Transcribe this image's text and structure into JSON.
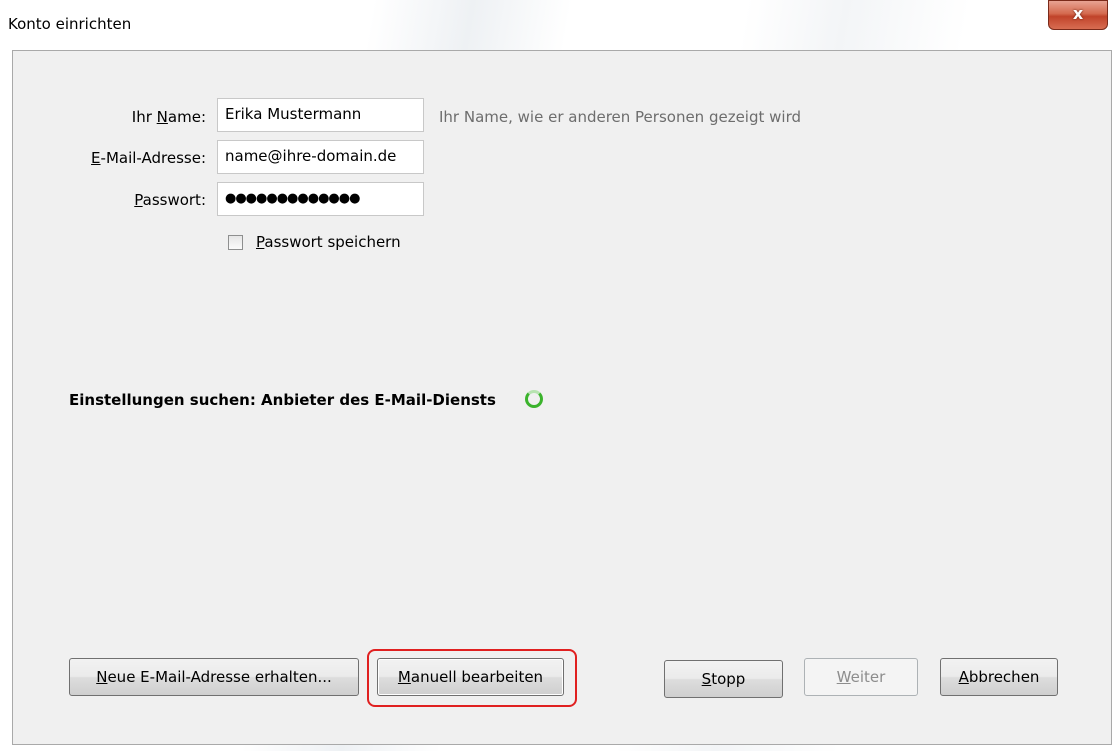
{
  "window": {
    "title": "Konto einrichten",
    "close_label": "x"
  },
  "form": {
    "name_label_pre": "Ihr ",
    "name_label_key": "N",
    "name_label_post": "ame:",
    "name_value": "Erika Mustermann",
    "name_hint": "Ihr Name, wie er anderen Personen gezeigt wird",
    "email_label_key": "E",
    "email_label_post": "-Mail-Adresse:",
    "email_value": "name@ihre-domain.de",
    "password_label_key": "P",
    "password_label_post": "asswort:",
    "password_value": "●●●●●●●●●●●●●",
    "remember_key": "P",
    "remember_post": "asswort speichern",
    "remember_checked": false
  },
  "status": {
    "text": "Einstellungen suchen: Anbieter des E-Mail-Diensts"
  },
  "buttons": {
    "new_address_key": "N",
    "new_address_post": "eue E-Mail-Adresse erhalten...",
    "manual_key": "M",
    "manual_post": "anuell bearbeiten",
    "stop_key": "S",
    "stop_post": "topp",
    "next_key": "W",
    "next_post": "eiter",
    "cancel_key": "A",
    "cancel_post": "bbrechen"
  },
  "colors": {
    "highlight": "#e02020",
    "spinner": "#3bb32c"
  }
}
